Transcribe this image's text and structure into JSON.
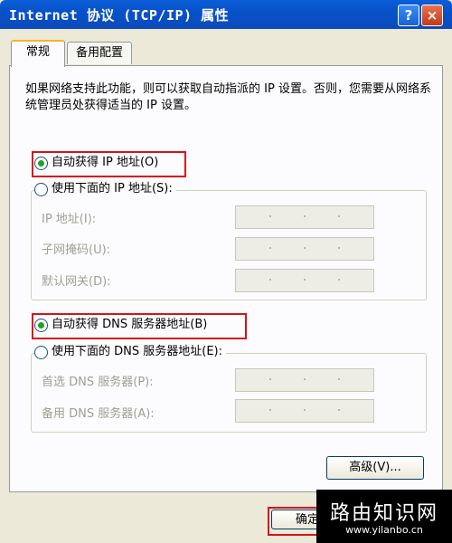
{
  "window": {
    "title": "Internet 协议 (TCP/IP) 属性",
    "help_label": "?",
    "close_label": "×"
  },
  "tabs": [
    {
      "label": "常规",
      "active": true
    },
    {
      "label": "备用配置",
      "active": false
    }
  ],
  "description": "如果网络支持此功能，则可以获取自动指派的 IP 设置。否则，您需要从网络系统管理员处获得适当的 IP 设置。",
  "ip_section": {
    "auto_label": "自动获得 IP 地址(O)",
    "auto_selected": true,
    "manual_label": "使用下面的 IP 地址(S):",
    "fields": [
      {
        "label": "IP 地址(I):"
      },
      {
        "label": "子网掩码(U):"
      },
      {
        "label": "默认网关(D):"
      }
    ]
  },
  "dns_section": {
    "auto_label": "自动获得 DNS 服务器地址(B)",
    "auto_selected": true,
    "manual_label": "使用下面的 DNS 服务器地址(E):",
    "fields": [
      {
        "label": "首选 DNS 服务器(P):"
      },
      {
        "label": "备用 DNS 服务器(A):"
      }
    ]
  },
  "advanced_button": "高级(V)...",
  "ok_button": "确定",
  "watermark": {
    "main": "路由知识网",
    "url": "www.yilanbo.cn"
  },
  "colors": {
    "highlight_box": "#d8121a",
    "titlebar": "#0a5fd8",
    "radio_selected": "#21a121"
  }
}
